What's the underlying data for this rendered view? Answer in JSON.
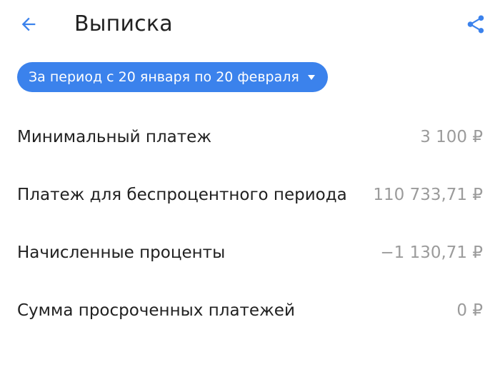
{
  "colors": {
    "accent": "#3b82ec",
    "text_primary": "#212121",
    "text_secondary": "#9b9b9b",
    "background": "#ffffff"
  },
  "header": {
    "back_icon": "arrow-left-icon",
    "title": "Выписка",
    "share_icon": "share-icon"
  },
  "period": {
    "label": "За период с 20 января по 20 февраля",
    "caret_icon": "caret-down-icon"
  },
  "rows": [
    {
      "label": "Минимальный платеж",
      "value": "3 100 ₽"
    },
    {
      "label": "Платеж для беспроцентного периода",
      "value": "110 733,71 ₽"
    },
    {
      "label": "Начисленные проценты",
      "value": "−1 130,71 ₽"
    },
    {
      "label": "Сумма просроченных платежей",
      "value": "0 ₽"
    }
  ]
}
